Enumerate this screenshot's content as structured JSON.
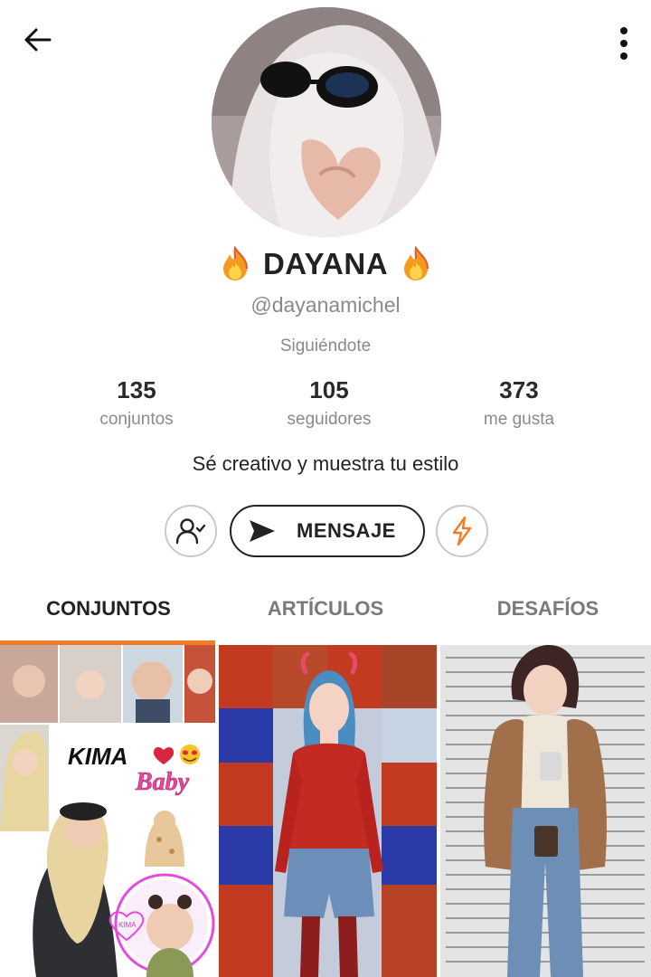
{
  "profile": {
    "display_name": "DAYANA",
    "handle": "@dayanamichel",
    "follow_status": "Siguiéndote",
    "bio": "Sé creativo y muestra tu estilo",
    "name_icon": "fire-emoji"
  },
  "stats": [
    {
      "value": "135",
      "label": "conjuntos"
    },
    {
      "value": "105",
      "label": "seguidores"
    },
    {
      "value": "373",
      "label": "me gusta"
    }
  ],
  "actions": {
    "message_label": "MENSAJE",
    "following_icon": "user-check-icon",
    "boost_icon": "lightning-icon",
    "message_icon": "send-icon"
  },
  "tabs": [
    {
      "label": "CONJUNTOS",
      "active": true
    },
    {
      "label": "ARTÍCULOS",
      "active": false
    },
    {
      "label": "DESAFÍOS",
      "active": false
    }
  ],
  "grid": {
    "tile1": {
      "title": "KIMA",
      "subtitle": "Baby",
      "badge": "KIMA"
    }
  },
  "colors": {
    "accent": "#f07c2a",
    "text": "#222222",
    "muted": "#8a8a8a",
    "border": "#c9c9c9"
  }
}
